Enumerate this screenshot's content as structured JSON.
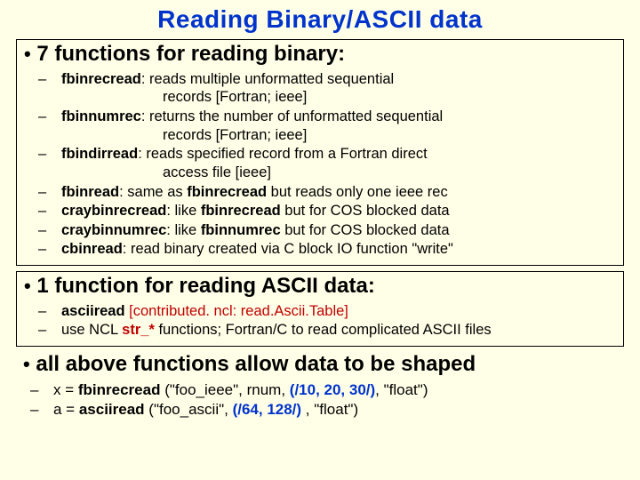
{
  "title": "Reading Binary/ASCII data",
  "section1": {
    "heading": "7 functions for reading binary:",
    "items": [
      {
        "fn": "fbinrecread",
        "desc": ": reads multiple unformatted sequential",
        "cont": "records [Fortran; ieee]"
      },
      {
        "fn": "fbinnumrec",
        "desc": ": returns the number of unformatted sequential",
        "cont": "records [Fortran; ieee]"
      },
      {
        "fn": "fbindirread",
        "desc": ":  reads specified record from a Fortran direct",
        "cont": "access file [ieee]"
      },
      {
        "fn": "fbinread",
        "pre": ":      same as ",
        "ref": "fbinrecread",
        "post": " but reads only one ieee rec"
      },
      {
        "fn": "craybinrecread",
        "pre": ": like ",
        "ref": "fbinrecread",
        "post": " but for COS blocked data"
      },
      {
        "fn": "craybinnumrec",
        "pre": ": like ",
        "ref": "fbinnumrec",
        "post": " but for COS blocked data"
      },
      {
        "fn": "cbinread",
        "desc": ":    read binary created via C block IO function \"write\""
      }
    ]
  },
  "section2": {
    "heading": "1 function for reading ASCII data:",
    "items": [
      {
        "fn": "asciiread",
        "pad": "        ",
        "contrib": "[contributed. ncl: read.Ascii.Table]"
      },
      {
        "pre": "use NCL ",
        "strfn": "str_*",
        "post": " functions;  Fortran/C to read complicated ASCII files"
      }
    ]
  },
  "section3": {
    "heading": "all above functions allow data to be shaped",
    "items": [
      {
        "lhs": "x = ",
        "fn": "fbinrecread",
        "mid": " (\"foo_ieee\",  rnum, ",
        "arr": "(/10, 20, 30/)",
        "rhs": ", \"float\")"
      },
      {
        "lhs": "a = ",
        "fn": "asciiread",
        "mid": " (\"foo_ascii\", ",
        "arr": "(/64, 128/)",
        "rhs": " , \"float\")"
      }
    ]
  }
}
